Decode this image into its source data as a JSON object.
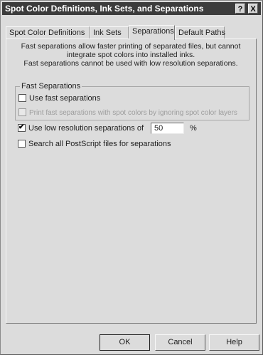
{
  "window": {
    "title": "Spot Color Definitions, Ink Sets, and Separations",
    "help_button": "?",
    "close_button": "X"
  },
  "tabs": [
    {
      "label": "Spot Color Definitions",
      "active": false
    },
    {
      "label": "Ink Sets",
      "active": false
    },
    {
      "label": "Separations",
      "active": true
    },
    {
      "label": "Default Paths",
      "active": false
    }
  ],
  "intro": {
    "line1": "Fast separations allow faster printing of separated files, but cannot",
    "line2": "integrate spot colors into installed inks.",
    "line3": "Fast separations cannot be used with low resolution separations."
  },
  "fast_separations": {
    "group_label": "Fast Separations",
    "use_fast_label": "Use fast separations",
    "use_fast_checked": false,
    "print_fast_label": "Print fast separations with spot colors by ignoring spot color layers",
    "print_fast_checked": false,
    "print_fast_enabled": false
  },
  "low_res": {
    "label": "Use low resolution separations of",
    "checked": true,
    "check_glyph": "✔",
    "value": "50",
    "unit": "%"
  },
  "search_postscript": {
    "label": "Search all PostScript files for separations",
    "checked": false
  },
  "buttons": {
    "ok": "OK",
    "cancel": "Cancel",
    "help": "Help"
  }
}
